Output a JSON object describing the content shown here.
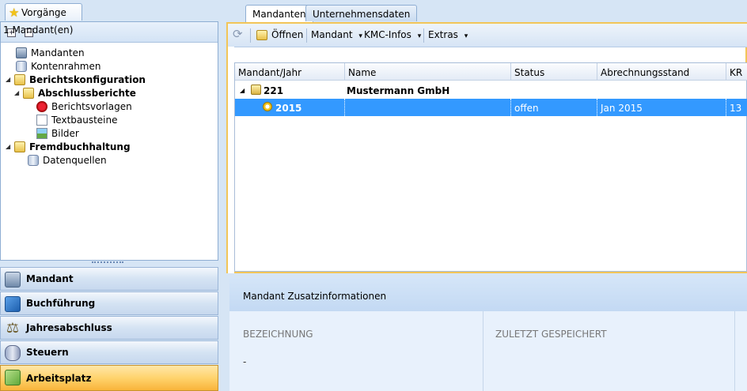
{
  "left_tab": {
    "label": "Vorgänge"
  },
  "tree_toolbar": {
    "expand": "+",
    "collapse": "−"
  },
  "tree": {
    "mandanten": "Mandanten",
    "kontenrahmen": "Kontenrahmen",
    "berichtskonfiguration": "Berichtskonfiguration",
    "abschlussberichte": "Abschlussberichte",
    "berichtsvorlagen": "Berichtsvorlagen",
    "textbausteine": "Textbausteine",
    "bilder": "Bilder",
    "fremdbuchhaltung": "Fremdbuchhaltung",
    "datenquellen": "Datenquellen"
  },
  "nav": {
    "mandant": "Mandant",
    "buchfuehrung": "Buchführung",
    "jahresabschluss": "Jahresabschluss",
    "steuern": "Steuern",
    "arbeitsplatz": "Arbeitsplatz"
  },
  "tabs": {
    "mandanten": "Mandanten",
    "unternehmensdaten": "Unternehmensdaten"
  },
  "toolbar": {
    "oeffnen": "Öffnen",
    "mandant": "Mandant",
    "kmc": "KMC-Infos",
    "extras": "Extras",
    "dropdown_glyph": "▾"
  },
  "count": "1 Mandant(en)",
  "grid": {
    "headers": {
      "mandant_jahr": "Mandant/Jahr",
      "name": "Name",
      "status": "Status",
      "abrechnungsstand": "Abrechnungsstand",
      "kr": "KR"
    },
    "row1": {
      "id": "221",
      "name": "Mustermann GmbH"
    },
    "row2": {
      "year": "2015",
      "status": "offen",
      "stand": "Jan 2015",
      "kr": "13"
    }
  },
  "info": {
    "title": "Mandant Zusatzinformationen",
    "bezeichnung_label": "BEZEICHNUNG",
    "bezeichnung_value": "-",
    "zuletzt_label": "ZULETZT GESPEICHERT"
  },
  "colors": {
    "selection": "#3399ff",
    "active_nav": "#ffd36d",
    "panel_border": "#f2c558"
  }
}
